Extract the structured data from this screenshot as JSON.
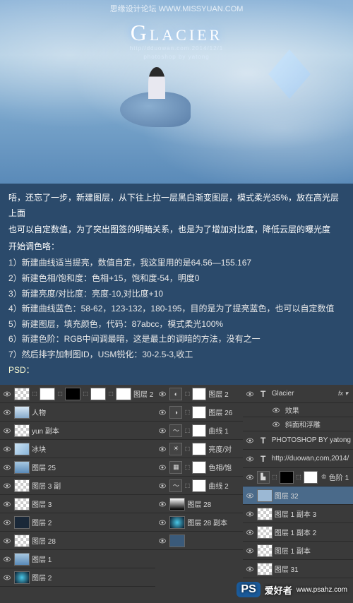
{
  "hero": {
    "forum": "思缘设计论坛  WWW.MISSYUAN.COM",
    "title": "Glacier",
    "sub1": "http//dduowan.com.2014/12/1",
    "sub2": "photoshop by yatong"
  },
  "instructions": {
    "intro1": "唔，还忘了一步，新建图层，从下往上拉一层黑白渐变图层，模式柔光35%，放在高光层上面",
    "intro2": "也可以自定数值，为了突出图签的明暗关系，也是为了增加对比度，降低云层的曝光度",
    "intro3": "开始调色咯：",
    "steps": [
      "1）新建曲线适当提亮，数值自定，我这里用的是64.56—155.167",
      "2）新建色相/饱和度：色相+15，饱和度-54，明度0",
      "3）新建亮度/对比度：亮度-10,对比度+10",
      "4）新建曲线蓝色：58-62，123-132，180-195，目的是为了提亮蓝色，也可以自定数值",
      "5）新建图层，填充颜色，代码：87abcc，模式柔光100%",
      "6）新建色阶：RGB中间调最暗，这是最土的调暗的方法，没有之一",
      "7）然后排字加制图ID，USM锐化：30-2.5-3,收工"
    ],
    "final": "PSD："
  },
  "panel1": [
    {
      "thumbs": [
        "checker",
        "white",
        "black",
        "white",
        "white"
      ],
      "label": "图层 2",
      "adj": true
    },
    {
      "thumbs": [
        "whalet"
      ],
      "label": "人物"
    },
    {
      "thumbs": [
        "checker"
      ],
      "label": "yun 副本"
    },
    {
      "thumbs": [
        "ice"
      ],
      "label": "冰块"
    },
    {
      "thumbs": [
        "sky"
      ],
      "label": "图层 25"
    },
    {
      "thumbs": [
        "checker"
      ],
      "label": "图层 3 副"
    },
    {
      "thumbs": [
        "checker"
      ],
      "label": "图层 3"
    },
    {
      "thumbs": [
        "dark"
      ],
      "label": "图层 2"
    },
    {
      "thumbs": [
        "checker"
      ],
      "label": "图层 28"
    },
    {
      "thumbs": [
        "sky"
      ],
      "label": "图层 1"
    },
    {
      "thumbs": [
        "glow"
      ],
      "label": "图层 2"
    }
  ],
  "panel2": [
    {
      "adj": "◐",
      "mask": "white",
      "label": "图层 2"
    },
    {
      "adj": "◑",
      "mask": "white",
      "label": "图层 26"
    },
    {
      "adj": "〜",
      "mask": "white",
      "label": "曲线 1"
    },
    {
      "adj": "☀",
      "mask": "white",
      "label": "亮度/对"
    },
    {
      "adj": "▦",
      "mask": "white",
      "label": "色相/饱"
    },
    {
      "adj": "〜",
      "mask": "white",
      "label": "曲线 2"
    },
    {
      "thumbs": [
        "grad"
      ],
      "label": "图层 28"
    },
    {
      "thumbs": [
        "glow"
      ],
      "label": "图层 28 副本"
    },
    {
      "thumbs": [
        "blue"
      ],
      "label": ""
    }
  ],
  "panel3": [
    {
      "type": "text",
      "label": "Glacier",
      "fx": "fx"
    },
    {
      "type": "sub",
      "label": "效果"
    },
    {
      "type": "sub",
      "label": "斜面和浮雕"
    },
    {
      "type": "text",
      "label": "PHOTOSHOP BY yatong"
    },
    {
      "type": "text",
      "label": "http://duowan,com,2014/"
    },
    {
      "adj": "▙",
      "mask": "black",
      "mask2": "white",
      "label": "色阶 1",
      "crown": true
    },
    {
      "thumbs": [
        "lightblue"
      ],
      "label": "图层 32",
      "selected": true
    },
    {
      "thumbs": [
        "checker"
      ],
      "label": "图层 1 副本 3"
    },
    {
      "thumbs": [
        "checker"
      ],
      "label": "图层 1 副本 2"
    },
    {
      "thumbs": [
        "checker"
      ],
      "label": "图层 1 副本"
    },
    {
      "thumbs": [
        "checker"
      ],
      "label": "图层 31"
    }
  ],
  "watermark": {
    "ps": "PS",
    "text": "爱好者",
    "url": "www.psahz.com"
  }
}
